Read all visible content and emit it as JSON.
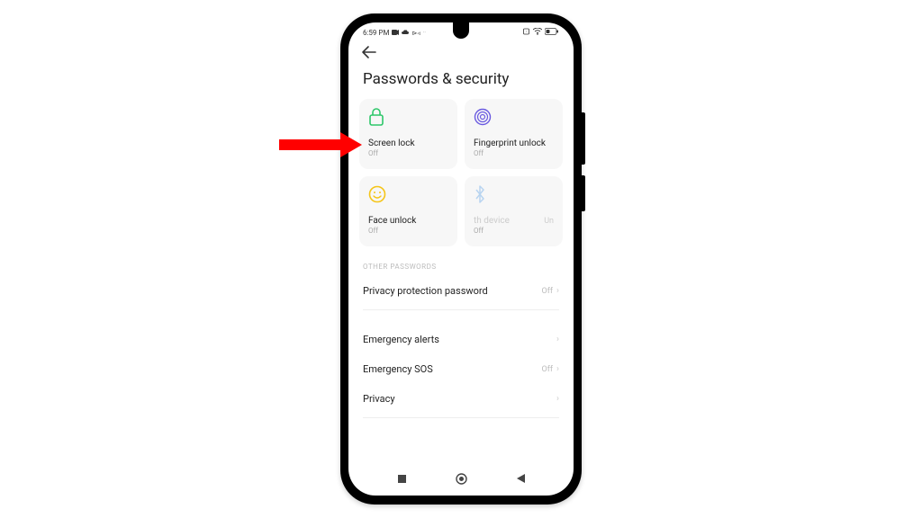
{
  "status": {
    "time": "6:59 PM"
  },
  "page": {
    "title": "Passwords & security"
  },
  "cards": [
    {
      "label": "Screen lock",
      "status": "Off",
      "icon": "lock"
    },
    {
      "label": "Fingerprint unlock",
      "status": "Off",
      "icon": "fingerprint"
    },
    {
      "label": "Face unlock",
      "status": "Off",
      "icon": "face"
    },
    {
      "label": "th device",
      "status": "Off",
      "extra": "Un",
      "icon": "bluetooth"
    }
  ],
  "sections": {
    "other_passwords": "OTHER PASSWORDS"
  },
  "rows": {
    "privacy_pw": {
      "label": "Privacy protection password",
      "status": "Off"
    },
    "emergency_alerts": {
      "label": "Emergency alerts"
    },
    "emergency_sos": {
      "label": "Emergency SOS",
      "status": "Off"
    },
    "privacy": {
      "label": "Privacy"
    }
  }
}
